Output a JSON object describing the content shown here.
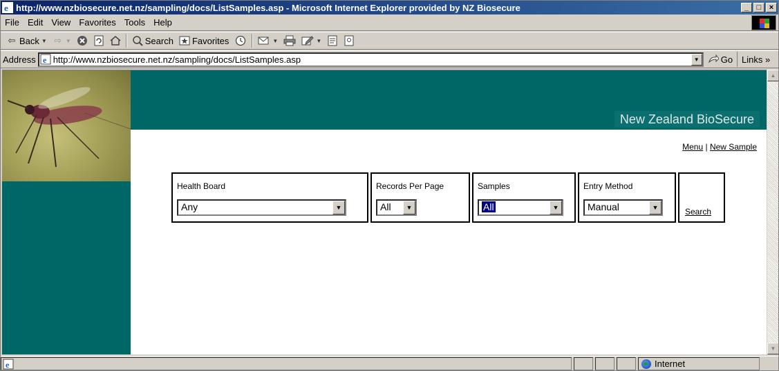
{
  "window": {
    "title": "http://www.nzbiosecure.net.nz/sampling/docs/ListSamples.asp - Microsoft Internet Explorer provided by NZ Biosecure",
    "minimize": "_",
    "maximize": "□",
    "close": "×"
  },
  "menu": {
    "file": "File",
    "edit": "Edit",
    "view": "View",
    "favorites": "Favorites",
    "tools": "Tools",
    "help": "Help"
  },
  "toolbar": {
    "back": "Back",
    "search": "Search",
    "favorites": "Favorites"
  },
  "address": {
    "label": "Address",
    "url": "http://www.nzbiosecure.net.nz/sampling/docs/ListSamples.asp",
    "go": "Go",
    "links": "Links »"
  },
  "page": {
    "brand": "New Zealand BioSecure",
    "menu_link": "Menu",
    "separator": "|",
    "new_sample_link": "New Sample"
  },
  "form": {
    "health_board": {
      "label": "Health Board",
      "value": "Any"
    },
    "records_per_page": {
      "label": "Records Per Page",
      "value": "All"
    },
    "samples": {
      "label": "Samples",
      "value": "All"
    },
    "entry_method": {
      "label": "Entry Method",
      "value": "Manual"
    },
    "search": "Search"
  },
  "status": {
    "zone": "Internet"
  },
  "colors": {
    "teal": "#006666",
    "title_bar": "#0a246a",
    "select_highlight": "#000080"
  }
}
